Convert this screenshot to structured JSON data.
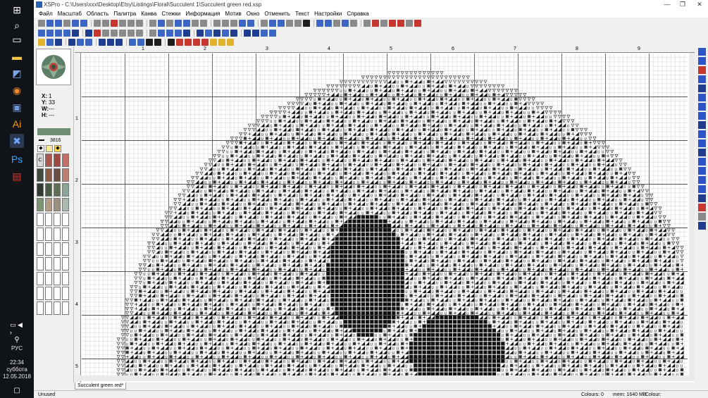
{
  "window": {
    "title": "XSPro - C:\\Users\\xxx\\Desktop\\Etsy\\Listings\\Floral\\Succulent 1\\Succulent green red.xsp",
    "minimize": "—",
    "restore": "❐",
    "close": "✕"
  },
  "menu": [
    "Файл",
    "Масштаб",
    "Область",
    "Палитра",
    "Канва",
    "Стежки",
    "Информация",
    "Мотив",
    "Окно",
    "Отменить",
    "Текст",
    "Настройки",
    "Справка"
  ],
  "coords": {
    "x_label": "X:",
    "x": "1",
    "y_label": "Y:",
    "y": "33",
    "w_label": "W:",
    "w": "---",
    "h_label": "H:",
    "h": "---"
  },
  "thread": {
    "number": "3816",
    "current_colour": "#6f8f72"
  },
  "palette_tools": [
    "◆",
    "",
    "◆"
  ],
  "palette_first_row_label": "C",
  "palette": [
    "#d9d9d9",
    "#a8584f",
    "#9a4a40",
    "#c36f66",
    "#3f4a3e",
    "#8b5a4b",
    "#6b4e42",
    "#b98072",
    "#2f3b30",
    "#4b5c45",
    "#5f6f56",
    "#8aa496",
    "#7c9470",
    "#b49b86",
    "#9d8f7e",
    "#a9b9ae"
  ],
  "ruler": {
    "top": [
      "1",
      "2",
      "3",
      "4",
      "5",
      "6",
      "7",
      "8",
      "9"
    ],
    "left": [
      "1",
      "2",
      "3",
      "4",
      "5"
    ]
  },
  "doc_tab": "Succulent green red*",
  "status": {
    "left": "Unused",
    "colours": "Colours: 0",
    "mem": "mem: 1640 MB",
    "colour": "Colour:"
  },
  "taskbar": {
    "lang": "РУС",
    "time": "22:34",
    "day": "суббота",
    "date": "12.05.2018"
  }
}
